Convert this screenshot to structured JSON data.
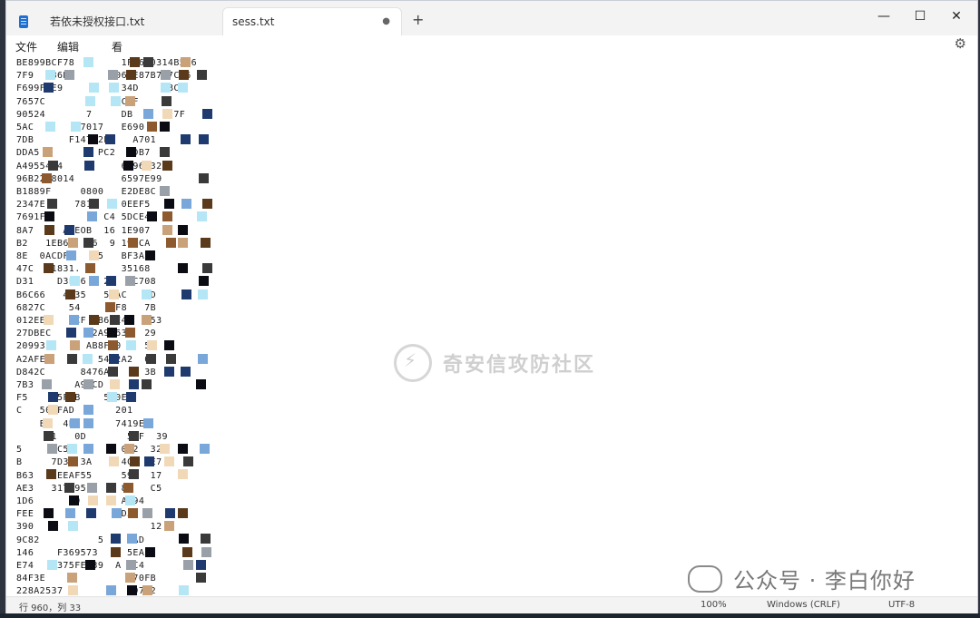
{
  "tabs": [
    {
      "label": "若依未授权接口.txt",
      "active": false
    },
    {
      "label": "sess.txt",
      "active": true,
      "modified_indicator": "●"
    }
  ],
  "new_tab": "+",
  "window_controls": {
    "minimize": "—",
    "maximize": "☐",
    "close": "✕"
  },
  "menu": {
    "file": "文件",
    "edit": "编辑",
    "view": "看"
  },
  "settings_icon": "gear-icon",
  "editor_lines": [
    "BE899BCF78        1F0610314B566",
    "7F9  C86B3       06DE87B787C86",
    "F699FBE9          34D     BC",
    "7657C             C1F",
    "90524       7     DB       7F",
    "5AC       27017   E690",
    "7DB      F147E2E    A701",
    "DDA5          PC2   DB7",
    "A4955424          6796C32",
    "96B2268014        6597E99",
    "B1889F     0800   E2DE8C",
    "2347E     781E    0EEF5",
    "7691F          C4 5DCE4",
    "8A7     AAEOB  16 1E907",
    "B2   1EB67   6  9 19FCA",
    "8E  0ACDF    F5   BF3A1",
    "47C  D1831.       35168",
    "D31    D3F16   22  4C708",
    "B6C66   4C35   59AC   6D",
    "6827C    54     FF8   7B",
    "012EEE    CF  B62E45   53",
    "27DBEC      72A9263   29",
    "209932      AB8F00    5A",
    "A2AFE0        54A2A2  0B",
    "D842C      8476AA     3B",
    "7B3       A99CD",
    "F5    C5F0B    5D0E",
    "C   503FAD       201",
    "    E   4E       7419E",
    "     31   0D       53F  39",
    "5      C5         0D2  32",
    "B     7D36 3A     4C   E7",
    "B63   7EEAF55     59   17",
    "AE3   317F95F     85   C5",
    "1D6      39       A394",
    "FEE               D3C",
    "390                    12",
    "9C82          5    CAD",
    "146    F369573     5EA",
    "E74    375FE839  A 8C4",
    "84F3E              570FB",
    "228A2537           59712"
  ],
  "watermark": {
    "text": "奇安信攻防社区",
    "icon": "lightning-shield-icon"
  },
  "wechat_watermark": {
    "text": "公众号 · 李白你好",
    "icon": "wechat-icon"
  },
  "status": {
    "position": "行 960，列 33",
    "zoom": "100%",
    "line_ending": "Windows (CRLF)",
    "encoding": "UTF-8"
  },
  "colors": {
    "titlebar_bg": "#f3f3f3",
    "editor_bg": "#ffffff",
    "mosaic": [
      "#1e3a6e",
      "#0b0b14",
      "#c9a27a",
      "#7aa7d9",
      "#b5e6f5",
      "#5a3a1a",
      "#f1d9b8",
      "#3a3a3a",
      "#8c5a2e",
      "#9aa0a8"
    ]
  }
}
